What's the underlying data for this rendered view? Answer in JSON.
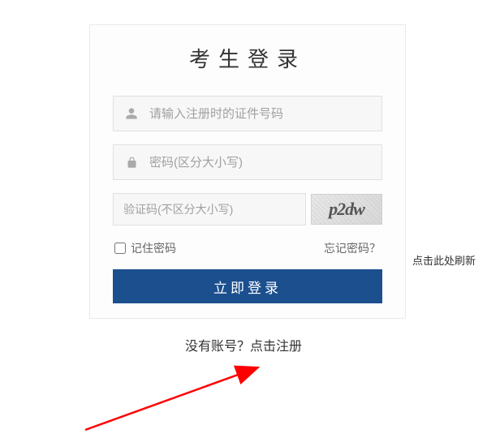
{
  "title": "考生登录",
  "username": {
    "placeholder": "请输入注册时的证件号码",
    "value": ""
  },
  "password": {
    "placeholder": "密码(区分大小写)",
    "value": ""
  },
  "captcha": {
    "placeholder": "验证码(不区分大小写)",
    "value": "",
    "image_text": "p2dw",
    "refresh_label": "点击此处刷新"
  },
  "remember": {
    "label": "记住密码",
    "checked": false
  },
  "forgot_label": "忘记密码？",
  "login_button": "立即登录",
  "register": {
    "prefix": "没有账号？",
    "link": "点击注册"
  }
}
